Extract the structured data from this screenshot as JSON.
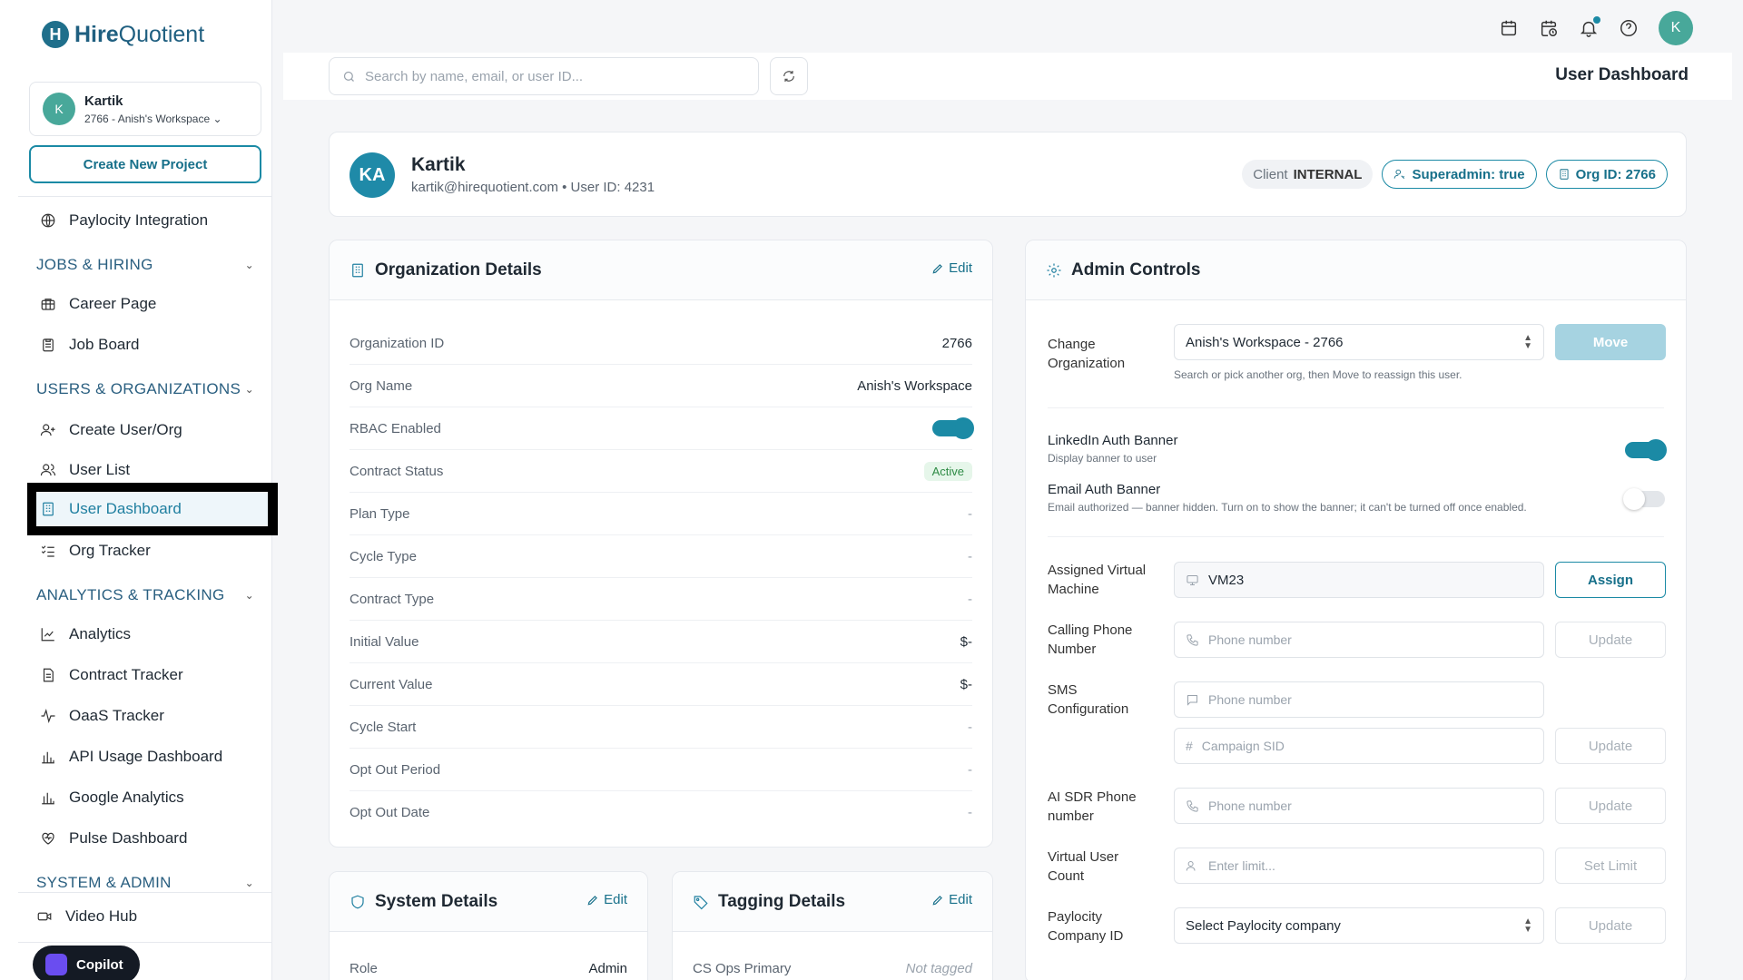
{
  "brand": {
    "logo_mark": "H",
    "name_bold": "Hire",
    "name_rest": "Quotient"
  },
  "workspace": {
    "avatar": "K",
    "name": "Kartik",
    "sub": "2766 - Anish's Workspace"
  },
  "create_project_label": "Create New Project",
  "nav": {
    "top_items": [
      {
        "label": "Paylocity Integration",
        "icon": "globe-icon"
      }
    ],
    "sections": [
      {
        "label": "JOBS & HIRING",
        "items": [
          {
            "label": "Career Page",
            "icon": "briefcase-icon"
          },
          {
            "label": "Job Board",
            "icon": "clipboard-icon"
          }
        ]
      },
      {
        "label": "USERS & ORGANIZATIONS",
        "items": [
          {
            "label": "Create User/Org",
            "icon": "user-plus-icon"
          },
          {
            "label": "User List",
            "icon": "users-icon"
          },
          {
            "label": "User Dashboard",
            "icon": "building-icon",
            "active": true
          },
          {
            "label": "Org Tracker",
            "icon": "list-check-icon"
          }
        ]
      },
      {
        "label": "ANALYTICS & TRACKING",
        "items": [
          {
            "label": "Analytics",
            "icon": "line-chart-icon"
          },
          {
            "label": "Contract Tracker",
            "icon": "document-icon"
          },
          {
            "label": "OaaS Tracker",
            "icon": "activity-icon"
          },
          {
            "label": "API Usage Dashboard",
            "icon": "bar-chart-icon"
          },
          {
            "label": "Google Analytics",
            "icon": "bar-chart-icon"
          },
          {
            "label": "Pulse Dashboard",
            "icon": "heart-pulse-icon"
          }
        ]
      },
      {
        "label": "SYSTEM & ADMIN",
        "items": []
      }
    ],
    "bottom_items": [
      {
        "label": "Video Hub",
        "icon": "video-icon"
      }
    ]
  },
  "copilot_label": "Copilot",
  "topbar": {
    "avatar": "K"
  },
  "search": {
    "placeholder": "Search by name, email, or user ID...",
    "value": ""
  },
  "page_title": "User Dashboard",
  "user": {
    "initials": "KA",
    "name": "Kartik",
    "email_line": "kartik@hirequotient.com • User ID: 4231",
    "client_prefix": "Client",
    "client_value": "INTERNAL",
    "superadmin": "Superadmin: true",
    "org_id": "Org ID: 2766"
  },
  "org_details": {
    "title": "Organization Details",
    "edit_label": "Edit",
    "rows": [
      {
        "key": "Organization ID",
        "value": "2766"
      },
      {
        "key": "Org Name",
        "value": "Anish's Workspace"
      },
      {
        "key": "RBAC Enabled",
        "value": ""
      },
      {
        "key": "Contract Status",
        "value": "Active"
      },
      {
        "key": "Plan Type",
        "value": "-"
      },
      {
        "key": "Cycle Type",
        "value": "-"
      },
      {
        "key": "Contract Type",
        "value": "-"
      },
      {
        "key": "Initial Value",
        "value": "$-"
      },
      {
        "key": "Current Value",
        "value": "$-"
      },
      {
        "key": "Cycle Start",
        "value": "-"
      },
      {
        "key": "Opt Out Period",
        "value": "-"
      },
      {
        "key": "Opt Out Date",
        "value": "-"
      }
    ],
    "rbac_enabled": true
  },
  "admin": {
    "title": "Admin Controls",
    "change_org_label": "Change Organization",
    "change_org_value": "Anish's Workspace - 2766",
    "move_label": "Move",
    "change_org_hint": "Search or pick another org, then Move to reassign this user.",
    "linkedin_title": "LinkedIn Auth Banner",
    "linkedin_sub": "Display banner to user",
    "linkedin_on": true,
    "email_title": "Email Auth Banner",
    "email_sub": "Email authorized — banner hidden. Turn on to show the banner; it can't be turned off once enabled.",
    "email_on": false,
    "vm_label": "Assigned Virtual Machine",
    "vm_value": "VM23",
    "assign_label": "Assign",
    "calling_label": "Calling Phone Number",
    "phone_placeholder": "Phone number",
    "update_label": "Update",
    "sms_label": "SMS Configuration",
    "campaign_placeholder": "Campaign SID",
    "ai_sdr_label": "AI SDR Phone number",
    "virtual_user_label": "Virtual User Count",
    "limit_placeholder": "Enter limit...",
    "set_limit_label": "Set Limit",
    "paylocity_label": "Paylocity Company ID",
    "paylocity_value": "Select Paylocity company"
  },
  "system_details": {
    "title": "System Details",
    "edit_label": "Edit",
    "row_key": "Role",
    "row_value": "Admin"
  },
  "tagging_details": {
    "title": "Tagging Details",
    "edit_label": "Edit",
    "row_key": "CS Ops Primary",
    "row_value": "Not tagged"
  },
  "colors": {
    "accent": "#1b8aa5",
    "accent_dark": "#17708a",
    "active_nav_bg": "#eef6fa"
  }
}
